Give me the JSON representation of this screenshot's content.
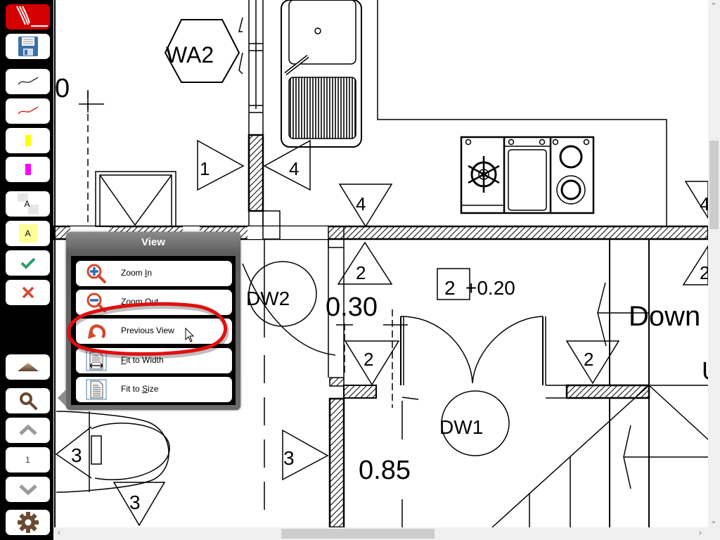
{
  "toolbar": {
    "items": [
      {
        "name": "app-logo-button",
        "icon": "pen-signature-icon"
      },
      {
        "name": "save-button",
        "icon": "floppy-disk-icon"
      },
      {
        "name": "pen-black-button",
        "icon": "black-pen-stroke-icon",
        "color": "#000000"
      },
      {
        "name": "pen-red-button",
        "icon": "red-pen-stroke-icon",
        "color": "#e01010"
      },
      {
        "name": "highlighter-yellow-button",
        "icon": "yellow-highlighter-icon",
        "color": "#ffff00"
      },
      {
        "name": "highlighter-magenta-button",
        "icon": "magenta-highlighter-icon",
        "color": "#ff00ff"
      },
      {
        "name": "text-box-button",
        "icon": "text-box-icon",
        "label": "A"
      },
      {
        "name": "text-highlight-button",
        "icon": "text-highlight-icon",
        "label": "A"
      },
      {
        "name": "accept-button",
        "icon": "check-icon",
        "color": "#2e9e6e"
      },
      {
        "name": "cancel-button",
        "icon": "close-icon",
        "color": "#d9432f"
      },
      {
        "name": "collapse-button",
        "icon": "triangle-up-icon"
      },
      {
        "name": "view-button",
        "icon": "magnifier-icon"
      },
      {
        "name": "previous-page-button",
        "icon": "chevron-up-icon"
      },
      {
        "name": "page-number",
        "label": "1"
      },
      {
        "name": "next-page-button",
        "icon": "chevron-down-icon"
      },
      {
        "name": "settings-button",
        "icon": "gear-icon"
      }
    ]
  },
  "view_menu": {
    "title": "View",
    "items": [
      {
        "label_pre": "Zoom ",
        "label_u": "I",
        "label_post": "n",
        "icon": "zoom-in-icon"
      },
      {
        "label_pre": "Zoom O",
        "label_u": "u",
        "label_post": "t",
        "icon": "zoom-out-icon"
      },
      {
        "label_pre": "Previous View",
        "label_u": "",
        "label_post": "",
        "icon": "undo-arrow-icon",
        "highlighted": true
      },
      {
        "label_pre": "",
        "label_u": "F",
        "label_post": "it to Width",
        "icon": "fit-width-icon"
      },
      {
        "label_pre": "Fit to ",
        "label_u": "S",
        "label_post": "ize",
        "icon": "fit-page-icon"
      }
    ]
  },
  "drawing": {
    "labels": {
      "wa2": "WA2",
      "dw2": "DW2",
      "dw1": "DW1",
      "zero": "0",
      "dim_030": "0.30",
      "dim_085": "0.85",
      "level": "+0.20",
      "level_box": "2",
      "down": "Down",
      "u": "U",
      "tag1": "1",
      "tag2": "2",
      "tag3": "3",
      "tag4": "4"
    }
  },
  "colors": {
    "accent_red": "#d40000",
    "icon_brown": "#6b4a32",
    "icon_red": "#d4482b",
    "icon_blue": "#2e6db4"
  }
}
